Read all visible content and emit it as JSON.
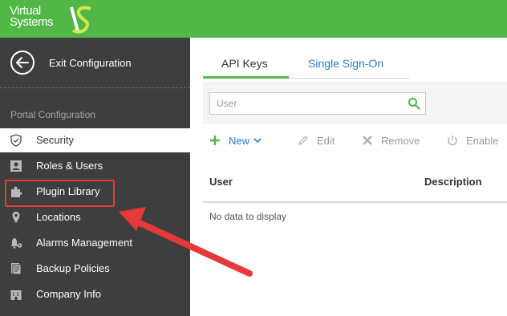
{
  "brand": {
    "line1": "Virtual",
    "line2": "Systems"
  },
  "sidebar": {
    "exit_label": "Exit Configuration",
    "section_title": "Portal Configuration",
    "items": [
      {
        "label": "Security",
        "icon": "shield-icon",
        "active": true
      },
      {
        "label": "Roles & Users",
        "icon": "user-card-icon"
      },
      {
        "label": "Plugin Library",
        "icon": "puzzle-icon"
      },
      {
        "label": "Locations",
        "icon": "map-pin-icon"
      },
      {
        "label": "Alarms Management",
        "icon": "bell-gear-icon"
      },
      {
        "label": "Backup Policies",
        "icon": "document-icon"
      },
      {
        "label": "Company Info",
        "icon": "building-icon"
      }
    ]
  },
  "tabs": [
    {
      "label": "API Keys",
      "active": true
    },
    {
      "label": "Single Sign-On"
    }
  ],
  "search": {
    "placeholder": "User"
  },
  "toolbar": {
    "new_label": "New",
    "edit_label": "Edit",
    "remove_label": "Remove",
    "enable_label": "Enable"
  },
  "table": {
    "columns": [
      "User",
      "Description"
    ],
    "empty_message": "No data to display"
  },
  "colors": {
    "brand_green": "#53b748",
    "sidebar_bg": "#3e3e3e",
    "link_blue": "#2a7bc0",
    "annotation_red": "#e5393a"
  }
}
